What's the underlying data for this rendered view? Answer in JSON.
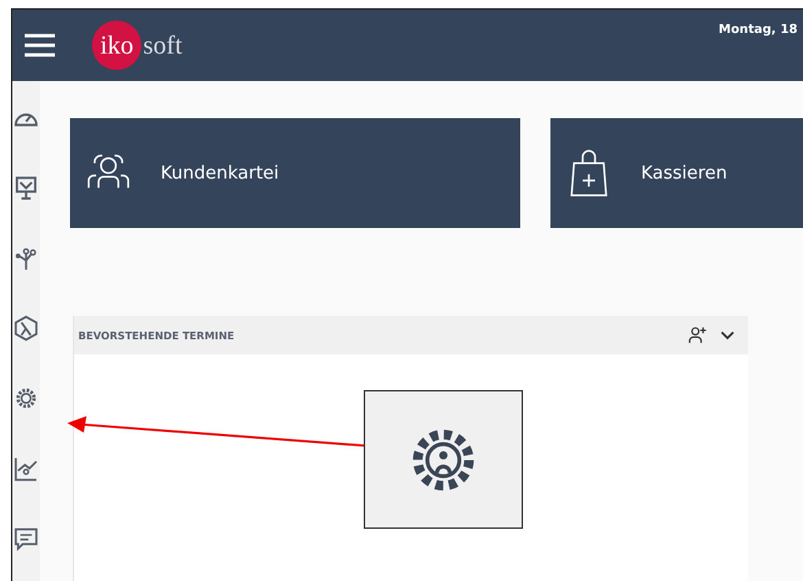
{
  "header": {
    "logo": {
      "main": "iko",
      "rest": "soft"
    },
    "date": "Montag, 18"
  },
  "tiles": [
    {
      "label": "Kundenkartei",
      "kind": "customers"
    },
    {
      "label": "Kassieren",
      "kind": "checkout"
    }
  ],
  "panel": {
    "title": "BEVORSTEHENDE TERMINE"
  }
}
